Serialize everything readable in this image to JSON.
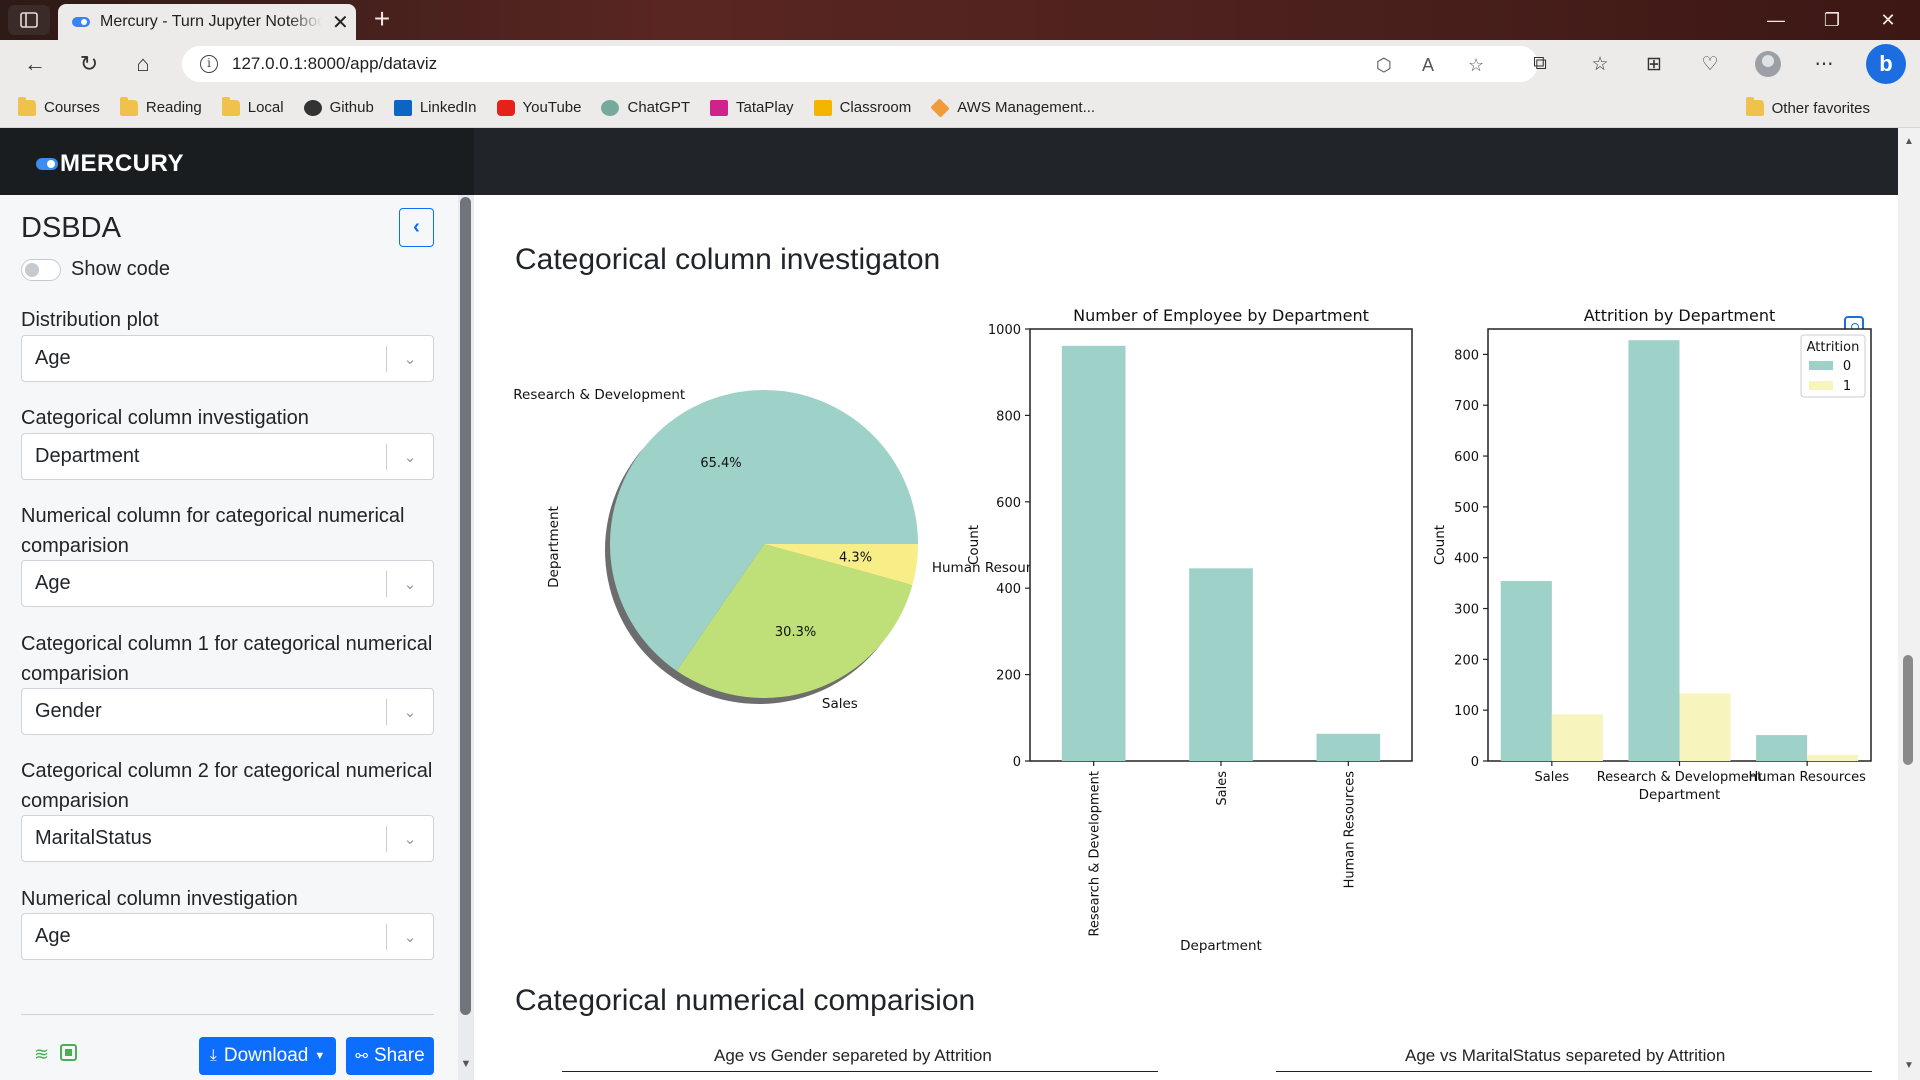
{
  "browser": {
    "tab_title": "Mercury - Turn Jupyter Notebook to Web App",
    "url": "127.0.0.1:8000/app/dataviz",
    "bookmarks": [
      "Courses",
      "Reading",
      "Local",
      "Github",
      "LinkedIn",
      "YouTube",
      "ChatGPT",
      "TataPlay",
      "Classroom",
      "AWS Management..."
    ],
    "other_favorites": "Other favorites"
  },
  "app": {
    "brand": "MERCURY"
  },
  "sidebar": {
    "notebook_title": "DSBDA",
    "show_code_label": "Show code",
    "widgets": [
      {
        "label": "Distribution plot",
        "value": "Age"
      },
      {
        "label": "Categorical column investigation",
        "value": "Department"
      },
      {
        "label": "Numerical column for categorical numerical comparision",
        "value": "Age"
      },
      {
        "label": "Categorical column 1 for categorical numerical comparision",
        "value": "Gender"
      },
      {
        "label": "Categorical column 2 for categorical numerical comparision",
        "value": "MaritalStatus"
      },
      {
        "label": "Numerical column investigation",
        "value": "Age"
      }
    ],
    "download_label": "Download",
    "share_label": "Share"
  },
  "main": {
    "heading1": "Categorical column investigaton",
    "heading2": "Categorical numerical comparision",
    "subplot_titles": [
      "Age vs Gender separeted by Attrition",
      "Age vs MaritalStatus separeted by Attrition"
    ]
  },
  "colors": {
    "teal": "#9ed1c7",
    "green": "#bfdf78",
    "yellow": "#f8ee88",
    "paleyellow": "#f8f4be",
    "accent": "#0d6efd"
  },
  "chart_data": [
    {
      "type": "pie",
      "ylabel": "Department",
      "labels": [
        "Research & Development",
        "Sales",
        "Human Resources"
      ],
      "label_text": [
        "Research & Development",
        "Sales",
        "Human Resourc"
      ],
      "values": [
        65.4,
        30.3,
        4.3
      ],
      "pct_labels": [
        "65.4%",
        "30.3%",
        "4.3%"
      ],
      "colors": [
        "#9ed1c7",
        "#bfdf78",
        "#f8ee88"
      ]
    },
    {
      "type": "bar",
      "title": "Number of Employee by Department",
      "xlabel": "Department",
      "ylabel": "Count",
      "categories": [
        "Research & Development",
        "Sales",
        "Human Resources"
      ],
      "values": [
        961,
        446,
        63
      ],
      "ylim": [
        0,
        1000
      ],
      "yticks": [
        0,
        200,
        400,
        600,
        800,
        1000
      ]
    },
    {
      "type": "bar",
      "title": "Attrition by Department",
      "xlabel": "Department",
      "ylabel": "Count",
      "categories": [
        "Sales",
        "Research & Development",
        "Human Resources"
      ],
      "legend_title": "Attrition",
      "legend_position": "top-right",
      "series": [
        {
          "name": "0",
          "values": [
            354,
            828,
            51
          ],
          "color": "#9ed1c7"
        },
        {
          "name": "1",
          "values": [
            92,
            133,
            12
          ],
          "color": "#f8f4be"
        }
      ],
      "ylim": [
        0,
        850
      ],
      "yticks": [
        0,
        100,
        200,
        300,
        400,
        500,
        600,
        700,
        800
      ]
    }
  ]
}
